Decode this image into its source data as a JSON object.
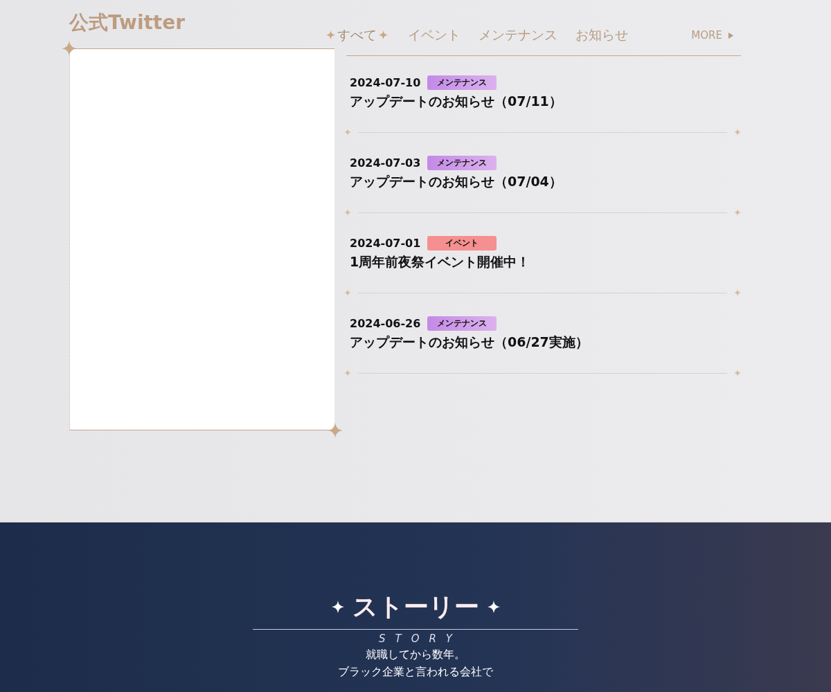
{
  "twitter": {
    "title": "公式Twitter"
  },
  "news": {
    "tabs": [
      {
        "label": "すべて",
        "selected": true
      },
      {
        "label": "イベント",
        "selected": false
      },
      {
        "label": "メンテナンス",
        "selected": false
      },
      {
        "label": "お知らせ",
        "selected": false
      }
    ],
    "more": "MORE",
    "items": [
      {
        "date": "2024-07-10",
        "tag": "メンテナンス",
        "kind": "maintenance",
        "title": "アップデートのお知らせ（07/11）"
      },
      {
        "date": "2024-07-03",
        "tag": "メンテナンス",
        "kind": "maintenance",
        "title": "アップデートのお知らせ（07/04）"
      },
      {
        "date": "2024-07-01",
        "tag": "イベント",
        "kind": "event",
        "title": "1周年前夜祭イベント開催中！"
      },
      {
        "date": "2024-06-26",
        "tag": "メンテナンス",
        "kind": "maintenance",
        "title": "アップデートのお知らせ（06/27実施）"
      }
    ]
  },
  "story": {
    "title": "ストーリー",
    "subtitle": "STORY",
    "lines": [
      "就職してから数年。",
      "ブラック企業と言われる会社で"
    ]
  }
}
